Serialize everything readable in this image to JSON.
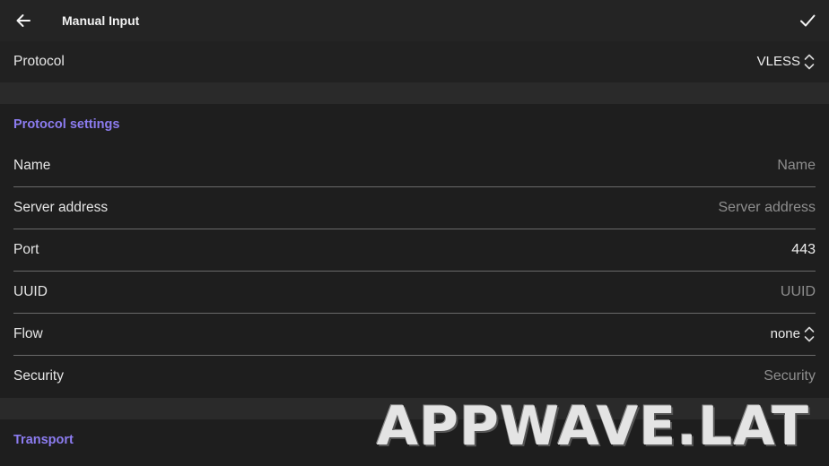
{
  "appbar": {
    "title": "Manual Input",
    "back_icon": "arrow-left-icon",
    "confirm_icon": "checkmark-icon"
  },
  "protocol": {
    "label": "Protocol",
    "value": "VLESS"
  },
  "protocol_settings": {
    "title": "Protocol settings",
    "accent_color": "#8c7cf0",
    "fields": [
      {
        "label": "Name",
        "placeholder": "Name",
        "value": ""
      },
      {
        "label": "Server address",
        "placeholder": "Server address",
        "value": ""
      },
      {
        "label": "Port",
        "placeholder": "",
        "value": "443"
      },
      {
        "label": "UUID",
        "placeholder": "UUID",
        "value": ""
      },
      {
        "label": "Flow",
        "select_value": "none"
      },
      {
        "label": "Security",
        "placeholder": "Security",
        "value": ""
      }
    ]
  },
  "transport": {
    "title": "Transport"
  },
  "watermark": "APPWAVE.LAT"
}
